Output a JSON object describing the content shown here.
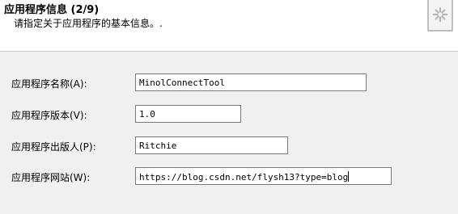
{
  "header": {
    "title": "应用程序信息 (2/9)",
    "subtitle": "请指定关于应用程序的基本信息。.",
    "icon": "document-gear-icon"
  },
  "fields": [
    {
      "label": "应用程序名称(A):",
      "value": "MinolConnectTool"
    },
    {
      "label": "应用程序版本(V):",
      "value": "1.0"
    },
    {
      "label": "应用程序出版人(P):",
      "value": "Ritchie"
    },
    {
      "label": "应用程序网站(W):",
      "value": "https://blog.csdn.net/flysh13?type=blog"
    }
  ]
}
